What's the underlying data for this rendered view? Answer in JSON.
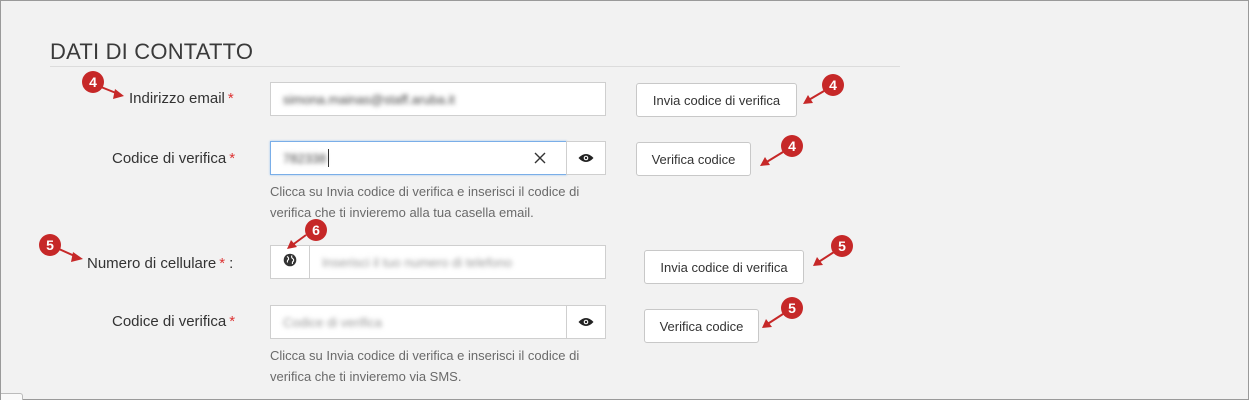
{
  "section": {
    "title": "DATI DI CONTATTO"
  },
  "email": {
    "label": "Indirizzo email",
    "required_mark": "*",
    "value": "simona.mainas@staff.aruba.it",
    "send_button": "Invia codice di verifica"
  },
  "email_code": {
    "label": "Codice di verifica",
    "required_mark": "*",
    "value": "782338",
    "verify_button": "Verifica codice",
    "help_line1": "Clicca su Invia codice di verifica e inserisci il codice di",
    "help_line2": "verifica che ti invieremo alla tua casella email."
  },
  "phone": {
    "label": "Numero di cellulare",
    "required_mark": "*",
    "label_suffix": ":",
    "placeholder": "Inserisci il tuo numero di telefono",
    "send_button": "Invia codice di verifica"
  },
  "phone_code": {
    "label": "Codice di verifica",
    "required_mark": "*",
    "placeholder": "Codice di verifica",
    "verify_button": "Verifica codice",
    "help_line1": "Clicca su Invia codice di verifica e inserisci il codice di",
    "help_line2": "verifica che ti invieremo via SMS."
  },
  "markers": {
    "email_label": "4",
    "email_send": "4",
    "email_verify": "4",
    "phone_label": "5",
    "phone_prefix": "6",
    "phone_send": "5",
    "phone_verify": "5"
  },
  "icons": {
    "clear": "close-icon",
    "reveal": "eye-icon",
    "country": "globe-icon"
  },
  "colors": {
    "required": "#d33333",
    "marker": "#c62828",
    "focus_border": "#7aaee8"
  }
}
